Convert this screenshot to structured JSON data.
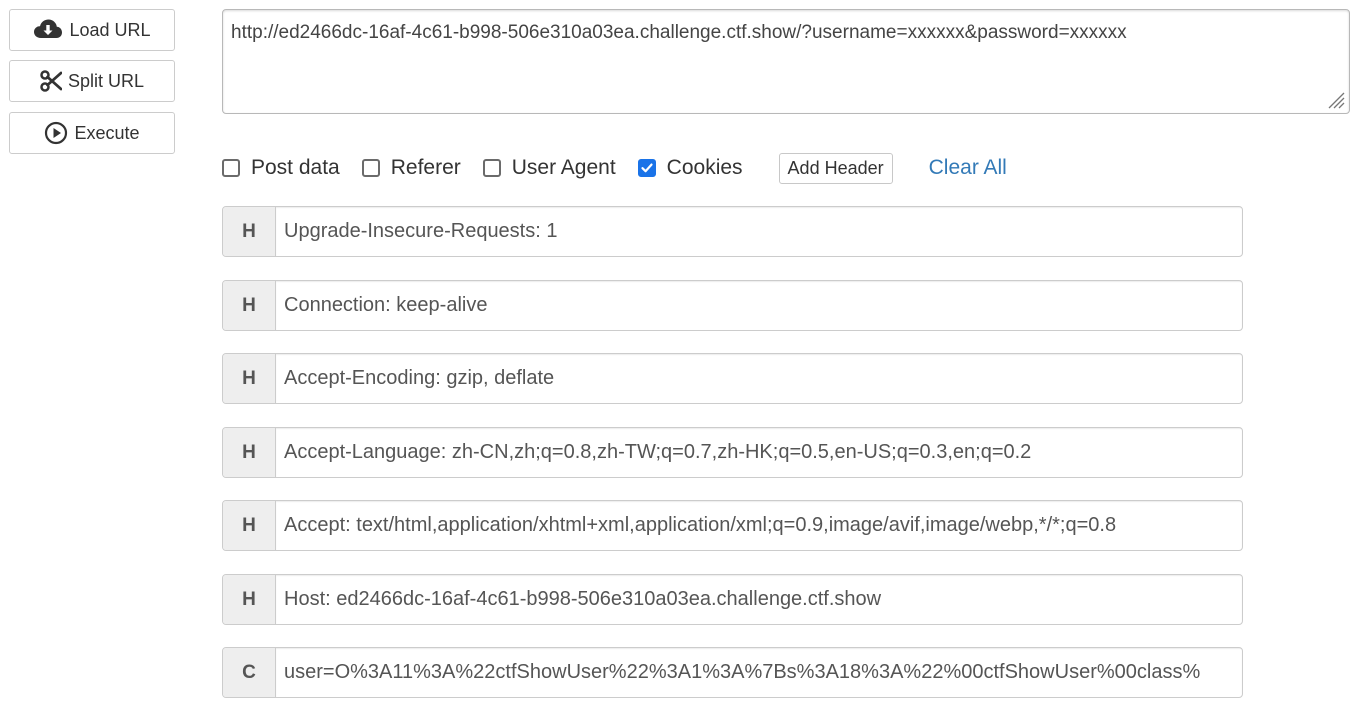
{
  "side_buttons": {
    "load_url": "Load URL",
    "split_url": "Split URL",
    "execute": "Execute"
  },
  "url": "http://ed2466dc-16af-4c61-b998-506e310a03ea.challenge.ctf.show/?username=xxxxxx&password=xxxxxx",
  "options": [
    {
      "label": "Post data",
      "checked": false
    },
    {
      "label": "Referer",
      "checked": false
    },
    {
      "label": "User Agent",
      "checked": false
    },
    {
      "label": "Cookies",
      "checked": true
    }
  ],
  "add_header_label": "Add Header",
  "clear_all_label": "Clear All",
  "colors": {
    "accent": "#1a73e8",
    "link": "#337ab7"
  },
  "headers": [
    {
      "tag": "H",
      "value": "Upgrade-Insecure-Requests: 1"
    },
    {
      "tag": "H",
      "value": "Connection: keep-alive"
    },
    {
      "tag": "H",
      "value": "Accept-Encoding: gzip, deflate"
    },
    {
      "tag": "H",
      "value": "Accept-Language: zh-CN,zh;q=0.8,zh-TW;q=0.7,zh-HK;q=0.5,en-US;q=0.3,en;q=0.2"
    },
    {
      "tag": "H",
      "value": "Accept: text/html,application/xhtml+xml,application/xml;q=0.9,image/avif,image/webp,*/*;q=0.8"
    },
    {
      "tag": "H",
      "value": "Host: ed2466dc-16af-4c61-b998-506e310a03ea.challenge.ctf.show"
    },
    {
      "tag": "C",
      "value": "user=O%3A11%3A%22ctfShowUser%22%3A1%3A%7Bs%3A18%3A%22%00ctfShowUser%00class%"
    }
  ]
}
